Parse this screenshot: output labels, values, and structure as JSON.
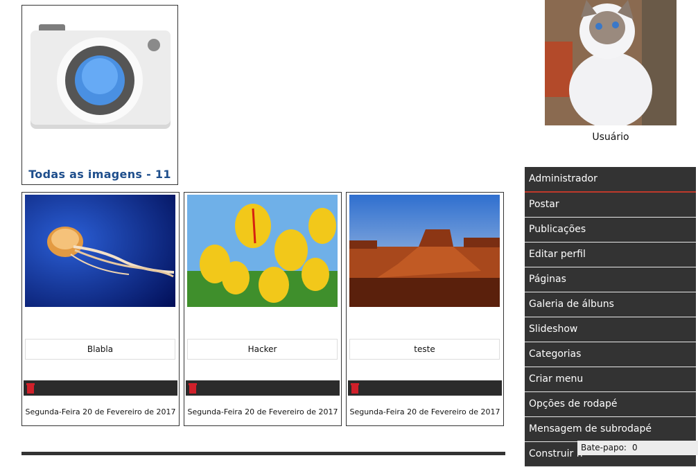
{
  "album": {
    "title": "Todas as imagens - 11"
  },
  "photos": [
    {
      "name": "Blabla",
      "date": "Segunda-Feira 20 de Fevereiro de 2017"
    },
    {
      "name": "Hacker",
      "date": "Segunda-Feira 20 de Fevereiro de 2017"
    },
    {
      "name": "teste",
      "date": "Segunda-Feira 20 de Fevereiro de 2017"
    }
  ],
  "user": {
    "name": "Usuário"
  },
  "menu": {
    "items": [
      {
        "label": "Administrador"
      },
      {
        "label": "Postar"
      },
      {
        "label": "Publicações"
      },
      {
        "label": "Editar perfil"
      },
      {
        "label": "Páginas"
      },
      {
        "label": "Galeria de álbuns"
      },
      {
        "label": "Slideshow"
      },
      {
        "label": "Categorias"
      },
      {
        "label": "Criar menu"
      },
      {
        "label": "Opções de rodapé"
      },
      {
        "label": "Mensagem de subrodapé"
      },
      {
        "label": "Construir h"
      }
    ]
  },
  "chat": {
    "label": "Bate-papo:",
    "count": "0"
  },
  "icons": {
    "camera": "camera-icon",
    "trash": "trash-icon"
  },
  "colors": {
    "accent": "#c0392b",
    "menu_bg": "#333333",
    "album_title": "#1e4e8c",
    "trash": "#d0202a"
  }
}
